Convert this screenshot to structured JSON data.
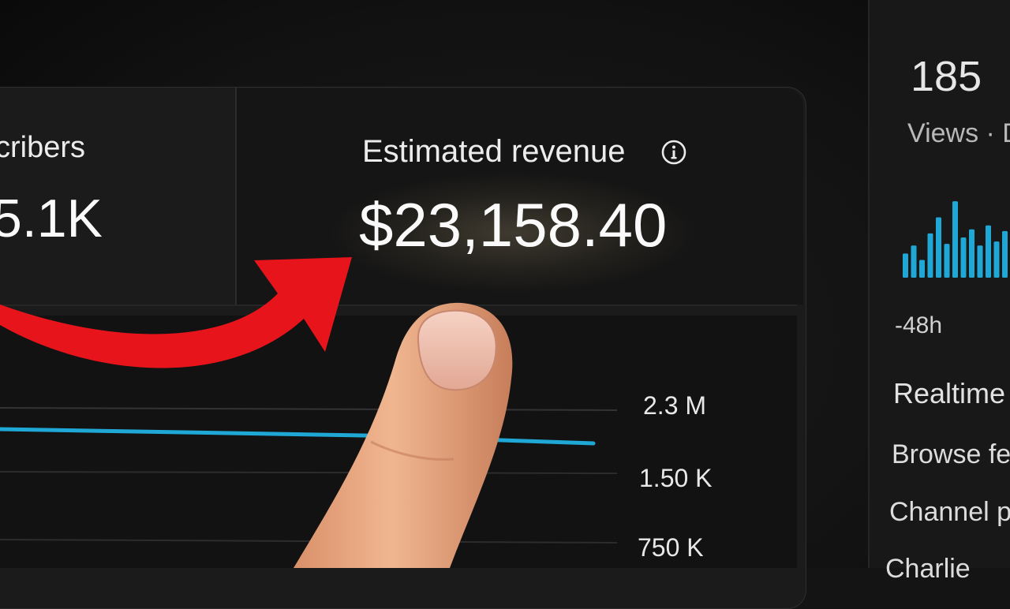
{
  "metrics": [
    {
      "label": "cribers",
      "value": "5.1K"
    },
    {
      "label": "Estimated revenue",
      "value": "$23,158.40",
      "info_icon": "info-icon"
    }
  ],
  "chart": {
    "ticks": [
      "2.3 M",
      "1.50 K",
      "750 K"
    ],
    "line_color": "#1fa8d6"
  },
  "realtime": {
    "views_count": "185",
    "views_label": "Views · D",
    "bar_color": "#1fa8d6",
    "bars": [
      0.3,
      0.4,
      0.22,
      0.55,
      0.75,
      0.42,
      0.95,
      0.5,
      0.6,
      0.4,
      0.65,
      0.45,
      0.58
    ],
    "time_label": "-48h",
    "section_title": "Realtime",
    "sources": [
      "Browse fe",
      "Channel p",
      "Charlie"
    ]
  },
  "overlay": {
    "arrow_color": "#e8141b",
    "pointer": "finger-pointer"
  }
}
